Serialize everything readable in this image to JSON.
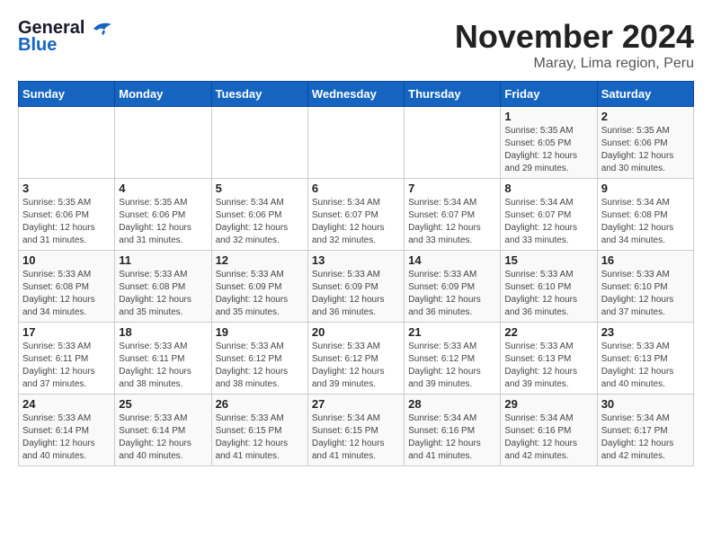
{
  "header": {
    "logo_line1": "General",
    "logo_line2": "Blue",
    "title": "November 2024",
    "subtitle": "Maray, Lima region, Peru"
  },
  "calendar": {
    "weekdays": [
      "Sunday",
      "Monday",
      "Tuesday",
      "Wednesday",
      "Thursday",
      "Friday",
      "Saturday"
    ],
    "weeks": [
      [
        {
          "day": "",
          "detail": ""
        },
        {
          "day": "",
          "detail": ""
        },
        {
          "day": "",
          "detail": ""
        },
        {
          "day": "",
          "detail": ""
        },
        {
          "day": "",
          "detail": ""
        },
        {
          "day": "1",
          "detail": "Sunrise: 5:35 AM\nSunset: 6:05 PM\nDaylight: 12 hours\nand 29 minutes."
        },
        {
          "day": "2",
          "detail": "Sunrise: 5:35 AM\nSunset: 6:06 PM\nDaylight: 12 hours\nand 30 minutes."
        }
      ],
      [
        {
          "day": "3",
          "detail": "Sunrise: 5:35 AM\nSunset: 6:06 PM\nDaylight: 12 hours\nand 31 minutes."
        },
        {
          "day": "4",
          "detail": "Sunrise: 5:35 AM\nSunset: 6:06 PM\nDaylight: 12 hours\nand 31 minutes."
        },
        {
          "day": "5",
          "detail": "Sunrise: 5:34 AM\nSunset: 6:06 PM\nDaylight: 12 hours\nand 32 minutes."
        },
        {
          "day": "6",
          "detail": "Sunrise: 5:34 AM\nSunset: 6:07 PM\nDaylight: 12 hours\nand 32 minutes."
        },
        {
          "day": "7",
          "detail": "Sunrise: 5:34 AM\nSunset: 6:07 PM\nDaylight: 12 hours\nand 33 minutes."
        },
        {
          "day": "8",
          "detail": "Sunrise: 5:34 AM\nSunset: 6:07 PM\nDaylight: 12 hours\nand 33 minutes."
        },
        {
          "day": "9",
          "detail": "Sunrise: 5:34 AM\nSunset: 6:08 PM\nDaylight: 12 hours\nand 34 minutes."
        }
      ],
      [
        {
          "day": "10",
          "detail": "Sunrise: 5:33 AM\nSunset: 6:08 PM\nDaylight: 12 hours\nand 34 minutes."
        },
        {
          "day": "11",
          "detail": "Sunrise: 5:33 AM\nSunset: 6:08 PM\nDaylight: 12 hours\nand 35 minutes."
        },
        {
          "day": "12",
          "detail": "Sunrise: 5:33 AM\nSunset: 6:09 PM\nDaylight: 12 hours\nand 35 minutes."
        },
        {
          "day": "13",
          "detail": "Sunrise: 5:33 AM\nSunset: 6:09 PM\nDaylight: 12 hours\nand 36 minutes."
        },
        {
          "day": "14",
          "detail": "Sunrise: 5:33 AM\nSunset: 6:09 PM\nDaylight: 12 hours\nand 36 minutes."
        },
        {
          "day": "15",
          "detail": "Sunrise: 5:33 AM\nSunset: 6:10 PM\nDaylight: 12 hours\nand 36 minutes."
        },
        {
          "day": "16",
          "detail": "Sunrise: 5:33 AM\nSunset: 6:10 PM\nDaylight: 12 hours\nand 37 minutes."
        }
      ],
      [
        {
          "day": "17",
          "detail": "Sunrise: 5:33 AM\nSunset: 6:11 PM\nDaylight: 12 hours\nand 37 minutes."
        },
        {
          "day": "18",
          "detail": "Sunrise: 5:33 AM\nSunset: 6:11 PM\nDaylight: 12 hours\nand 38 minutes."
        },
        {
          "day": "19",
          "detail": "Sunrise: 5:33 AM\nSunset: 6:12 PM\nDaylight: 12 hours\nand 38 minutes."
        },
        {
          "day": "20",
          "detail": "Sunrise: 5:33 AM\nSunset: 6:12 PM\nDaylight: 12 hours\nand 39 minutes."
        },
        {
          "day": "21",
          "detail": "Sunrise: 5:33 AM\nSunset: 6:12 PM\nDaylight: 12 hours\nand 39 minutes."
        },
        {
          "day": "22",
          "detail": "Sunrise: 5:33 AM\nSunset: 6:13 PM\nDaylight: 12 hours\nand 39 minutes."
        },
        {
          "day": "23",
          "detail": "Sunrise: 5:33 AM\nSunset: 6:13 PM\nDaylight: 12 hours\nand 40 minutes."
        }
      ],
      [
        {
          "day": "24",
          "detail": "Sunrise: 5:33 AM\nSunset: 6:14 PM\nDaylight: 12 hours\nand 40 minutes."
        },
        {
          "day": "25",
          "detail": "Sunrise: 5:33 AM\nSunset: 6:14 PM\nDaylight: 12 hours\nand 40 minutes."
        },
        {
          "day": "26",
          "detail": "Sunrise: 5:33 AM\nSunset: 6:15 PM\nDaylight: 12 hours\nand 41 minutes."
        },
        {
          "day": "27",
          "detail": "Sunrise: 5:34 AM\nSunset: 6:15 PM\nDaylight: 12 hours\nand 41 minutes."
        },
        {
          "day": "28",
          "detail": "Sunrise: 5:34 AM\nSunset: 6:16 PM\nDaylight: 12 hours\nand 41 minutes."
        },
        {
          "day": "29",
          "detail": "Sunrise: 5:34 AM\nSunset: 6:16 PM\nDaylight: 12 hours\nand 42 minutes."
        },
        {
          "day": "30",
          "detail": "Sunrise: 5:34 AM\nSunset: 6:17 PM\nDaylight: 12 hours\nand 42 minutes."
        }
      ]
    ]
  }
}
